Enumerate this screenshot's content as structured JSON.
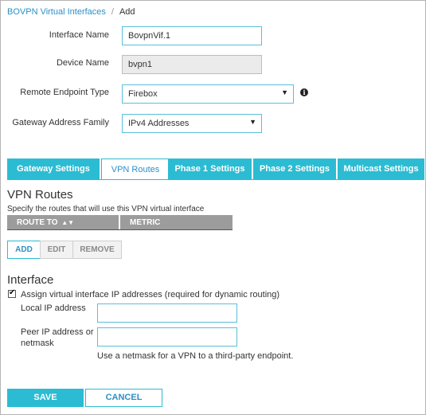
{
  "breadcrumb": {
    "parent": "BOVPN Virtual Interfaces",
    "separator": "/",
    "current": "Add"
  },
  "form": {
    "interface_name": {
      "label": "Interface Name",
      "value": "BovpnVif.1"
    },
    "device_name": {
      "label": "Device Name",
      "value": "bvpn1"
    },
    "remote_endpoint_type": {
      "label": "Remote Endpoint Type",
      "value": "Firebox",
      "info_icon": "info-icon"
    },
    "gateway_address_family": {
      "label": "Gateway Address Family",
      "value": "IPv4 Addresses"
    }
  },
  "tabs": [
    {
      "label": "Gateway Settings",
      "active": false
    },
    {
      "label": "VPN Routes",
      "active": true
    },
    {
      "label": "Phase 1 Settings",
      "active": false
    },
    {
      "label": "Phase 2 Settings",
      "active": false
    },
    {
      "label": "Multicast Settings",
      "active": false
    }
  ],
  "vpn_routes": {
    "title": "VPN Routes",
    "description": "Specify the routes that will use this VPN virtual interface",
    "columns": [
      {
        "label": "ROUTE TO",
        "sort_icon": "sort-icon"
      },
      {
        "label": "METRIC"
      }
    ],
    "rows": [],
    "actions": {
      "add": "ADD",
      "edit": "EDIT",
      "remove": "REMOVE"
    }
  },
  "interface": {
    "title": "Interface",
    "assign_checkbox": {
      "label": "Assign virtual interface IP addresses (required for dynamic routing)",
      "checked": true
    },
    "local_ip": {
      "label": "Local IP address",
      "value": ""
    },
    "peer_ip": {
      "label": "Peer IP address or netmask",
      "value": ""
    },
    "hint": "Use a netmask for a VPN to a third-party endpoint."
  },
  "footer": {
    "save": "SAVE",
    "cancel": "CANCEL"
  },
  "colors": {
    "accent": "#2bbcd3",
    "link": "#2a91c7",
    "header_gray": "#9c9c9c",
    "readonly_bg": "#ebebeb"
  }
}
